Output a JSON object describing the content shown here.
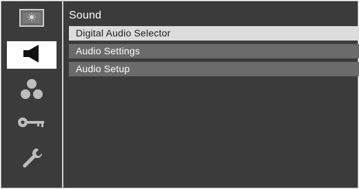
{
  "sidebar": {
    "items": [
      {
        "icon": "picture-icon",
        "active": false
      },
      {
        "icon": "speaker-icon",
        "active": true
      },
      {
        "icon": "channel-dots-icon",
        "active": false
      },
      {
        "icon": "key-lock-icon",
        "active": false
      },
      {
        "icon": "wrench-icon",
        "active": false
      }
    ]
  },
  "main": {
    "title": "Sound",
    "items": [
      {
        "label": "Digital Audio Selector",
        "selected": true
      },
      {
        "label": "Audio Settings",
        "selected": false
      },
      {
        "label": "Audio Setup",
        "selected": false
      }
    ]
  },
  "colors": {
    "background": "#3b3b3b",
    "selected_item": "#dcdcdc",
    "menu_item": "#6b6b6b",
    "active_tab": "#ffffff"
  }
}
